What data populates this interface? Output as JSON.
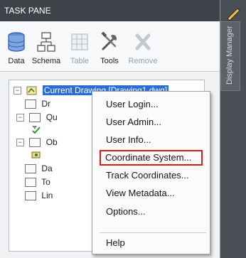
{
  "taskpane": {
    "title": "TASK PANE",
    "close_glyph": "×"
  },
  "toolbar": {
    "tools": [
      {
        "label": "Data",
        "icon": "database-icon",
        "enabled": true
      },
      {
        "label": "Schema",
        "icon": "schema-icon",
        "enabled": true
      },
      {
        "label": "Table",
        "icon": "table-icon",
        "enabled": false
      },
      {
        "label": "Tools",
        "icon": "tools-icon",
        "enabled": true
      },
      {
        "label": "Remove",
        "icon": "remove-icon",
        "enabled": false
      }
    ]
  },
  "tree": {
    "root": "Current Drawing [Drawing1.dwg]",
    "items": [
      {
        "text": "Dr"
      },
      {
        "text": "Qu"
      },
      {
        "text": ""
      },
      {
        "text": "Ob"
      },
      {
        "text": ""
      },
      {
        "text": "Da"
      },
      {
        "text": "To"
      },
      {
        "text": "Lin"
      }
    ]
  },
  "sidebar": {
    "tab_label": "Display Manager"
  },
  "context_menu": {
    "items": [
      {
        "label": "User Login..."
      },
      {
        "label": "User Admin..."
      },
      {
        "label": "User Info..."
      },
      {
        "label": "Coordinate System...",
        "highlighted": true
      },
      {
        "label": "Track Coordinates..."
      },
      {
        "label": "View Metadata..."
      },
      {
        "label": "Options..."
      },
      {
        "label": "Help"
      }
    ]
  },
  "colors": {
    "selection": "#2c6bd6",
    "highlight_border": "#d91b1b",
    "titlebar": "#3f4349"
  }
}
